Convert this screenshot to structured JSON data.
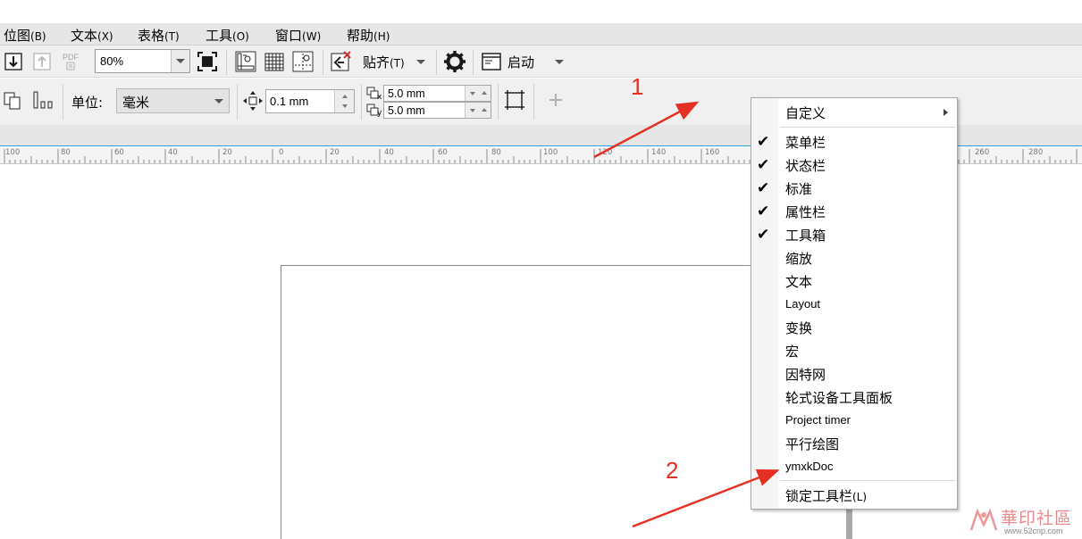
{
  "menubar": {
    "items": [
      {
        "label": "位图",
        "accel": "(B)"
      },
      {
        "label": "文本",
        "accel": "(X)"
      },
      {
        "label": "表格",
        "accel": "(T)"
      },
      {
        "label": "工具",
        "accel": "(O)"
      },
      {
        "label": "窗口",
        "accel": "(W)"
      },
      {
        "label": "帮助",
        "accel": "(H)"
      }
    ]
  },
  "toolbar": {
    "zoom_value": "80%",
    "pdf_label": "PDF",
    "snap_label": "贴齐",
    "snap_accel": "(T)",
    "launch_label": "启动"
  },
  "propbar": {
    "unit_label": "单位:",
    "unit_value": "毫米",
    "nudge_value": "0.1 mm",
    "dup_x_value": "5.0 mm",
    "dup_y_value": "5.0 mm",
    "dup_x_sub": "x",
    "dup_y_sub": "y"
  },
  "ruler": {
    "labels": [
      "100",
      "80",
      "60",
      "40",
      "20",
      "0",
      "20",
      "40",
      "60",
      "80",
      "100",
      "120",
      "140",
      "160",
      "260",
      "280"
    ]
  },
  "context_menu": {
    "customize_label": "自定义",
    "items": [
      {
        "label": "菜单栏",
        "checked": true
      },
      {
        "label": "状态栏",
        "checked": true
      },
      {
        "label": "标准",
        "checked": true
      },
      {
        "label": "属性栏",
        "checked": true
      },
      {
        "label": "工具箱",
        "checked": true
      },
      {
        "label": "缩放",
        "checked": false
      },
      {
        "label": "文本",
        "checked": false
      },
      {
        "label": "Layout",
        "checked": false
      },
      {
        "label": "变换",
        "checked": false
      },
      {
        "label": "宏",
        "checked": false
      },
      {
        "label": "因特网",
        "checked": false
      },
      {
        "label": "轮式设备工具面板",
        "checked": false
      },
      {
        "label": "Project timer",
        "checked": false
      },
      {
        "label": "平行绘图",
        "checked": false
      },
      {
        "label": "ymxkDoc",
        "checked": false
      }
    ],
    "lock_label": "锁定工具栏",
    "lock_accel": "(L)",
    "check_mark": "✔"
  },
  "annotations": {
    "marker_1": "1",
    "marker_2": "2",
    "color": "#e53125"
  },
  "watermark": {
    "text": "華印社區",
    "url": "www.52cnp.com"
  },
  "colors": {
    "menubar_bg": "#e6e6e6",
    "toolbar_bg": "#f0f0f0",
    "ruler_accent": "#2e9de0"
  }
}
